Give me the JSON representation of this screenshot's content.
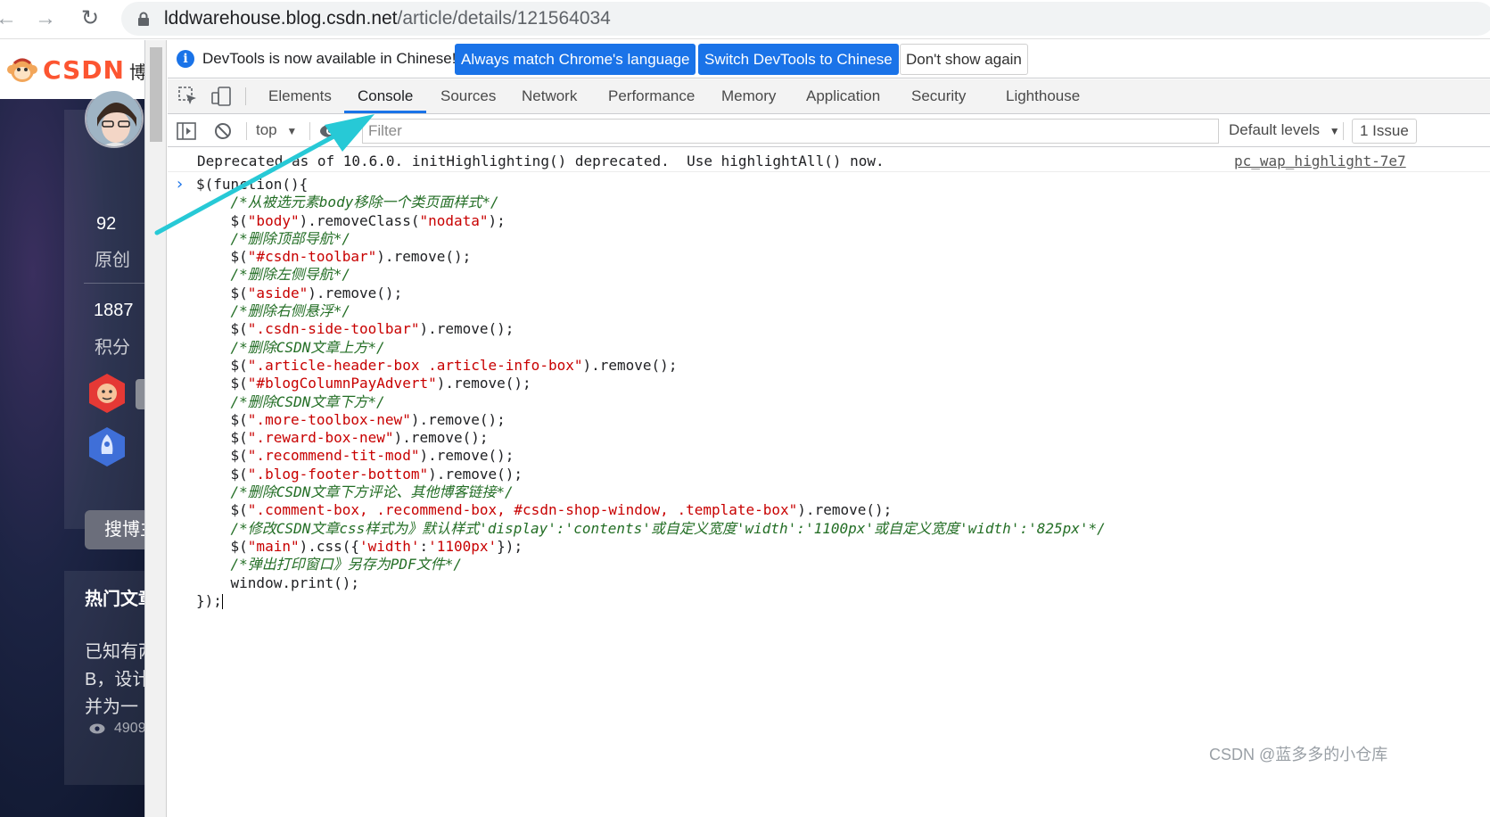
{
  "browser": {
    "url_host": "lddwarehouse.blog.csdn.net",
    "url_path": "/article/details/121564034"
  },
  "csdn": {
    "logo_text": "CSDN",
    "nav_fragment": "博",
    "stats": [
      {
        "value": "92",
        "label": "原创"
      },
      {
        "value": "1887",
        "label": "积分"
      }
    ],
    "search_button": "搜博主",
    "hot_title": "热门文章",
    "hot_lines": [
      "已知有两",
      "B，设计",
      "并为一"
    ],
    "views": "4909"
  },
  "devtools": {
    "infobar": {
      "message": "DevTools is now available in Chinese!",
      "btn_match": "Always match Chrome's language",
      "btn_switch": "Switch DevTools to Chinese",
      "btn_dont_show": "Don't show again"
    },
    "tabs": [
      "Elements",
      "Console",
      "Sources",
      "Network",
      "Performance",
      "Memory",
      "Application",
      "Security",
      "Lighthouse"
    ],
    "active_tab": "Console",
    "toolbar": {
      "context": "top",
      "filter_placeholder": "Filter",
      "levels": "Default levels",
      "issues": "1 Issue"
    },
    "message": {
      "text": "Deprecated as of 10.6.0. initHighlighting() deprecated.  Use highlightAll() now.",
      "source": "pc_wap_highlight-7e7"
    }
  },
  "watermark": "CSDN @蓝多多的小仓库",
  "colors": {
    "accent": "#1a73e8",
    "comment": "#236e25",
    "string": "#c80000",
    "annotation_arrow": "#27c9d6",
    "csdn_brand": "#fc5531"
  }
}
